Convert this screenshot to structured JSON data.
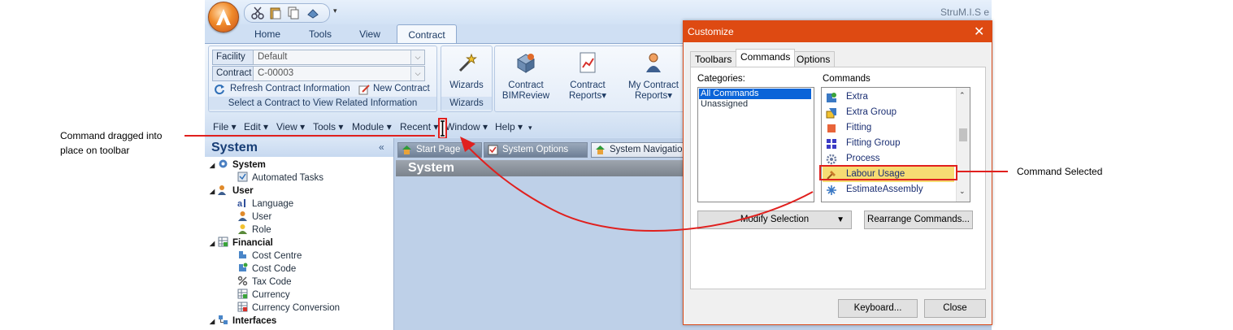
{
  "app": {
    "title": "StruM.I.S e",
    "ribbon_tabs": [
      "Home",
      "Tools",
      "View",
      "Contract"
    ],
    "active_tab": "Contract",
    "contract_group": {
      "facility_label": "Facility",
      "facility_value": "Default",
      "contract_label": "Contract",
      "contract_value": "C-00003",
      "refresh_label": "Refresh Contract Information",
      "new_contract_label": "New Contract",
      "group_label": "Select a Contract to View Related Information"
    },
    "wizards_group": {
      "button_label": "Wizards",
      "group_label": "Wizards"
    },
    "big_buttons": [
      {
        "line1": "Contract",
        "line2": "BIMReview"
      },
      {
        "line1": "Contract",
        "line2": "Reports▾"
      },
      {
        "line1": "My Contract",
        "line2": "Reports▾"
      }
    ],
    "menu": [
      "File ▾",
      "Edit ▾",
      "View ▾",
      "Tools ▾",
      "Module ▾",
      "Recent ▾",
      "Window ▾",
      "Help ▾"
    ],
    "side_panel": {
      "title": "System",
      "collapse": "«",
      "tree": [
        {
          "label": "System",
          "level": 0
        },
        {
          "label": "Automated Tasks",
          "level": 1
        },
        {
          "label": "User",
          "level": 0
        },
        {
          "label": "Language",
          "level": 1
        },
        {
          "label": "User",
          "level": 1
        },
        {
          "label": "Role",
          "level": 1
        },
        {
          "label": "Financial",
          "level": 0
        },
        {
          "label": "Cost Centre",
          "level": 1
        },
        {
          "label": "Cost Code",
          "level": 1
        },
        {
          "label": "Tax Code",
          "level": 1
        },
        {
          "label": "Currency",
          "level": 1
        },
        {
          "label": "Currency Conversion",
          "level": 1
        },
        {
          "label": "Interfaces",
          "level": 0
        }
      ]
    },
    "doc_tabs": [
      "Start Page",
      "System Options",
      "System Navigation"
    ],
    "doc_header": "System"
  },
  "dialog": {
    "title": "Customize",
    "close": "✕",
    "tabs": [
      "Toolbars",
      "Commands",
      "Options"
    ],
    "active_tab": "Commands",
    "categories_label": "Categories:",
    "categories": [
      "All Commands",
      "Unassigned"
    ],
    "selected_category": "All Commands",
    "commands_label": "Commands",
    "commands": [
      "Extra",
      "Extra Group",
      "Fitting",
      "Fitting Group",
      "Process",
      "Labour Usage",
      "EstimateAssembly"
    ],
    "selected_command": "Labour Usage",
    "modify_selection": "Modify Selection",
    "rearrange_commands": "Rearrange Commands...",
    "keyboard": "Keyboard...",
    "close_button": "Close"
  },
  "annotations": {
    "left_line1": "Command dragged into",
    "left_line2": "place on toolbar",
    "right": "Command Selected"
  },
  "colors": {
    "accent_red": "#e0201e",
    "dialog_title": "#de4a12",
    "ribbon_blue": "#cfdff3"
  }
}
